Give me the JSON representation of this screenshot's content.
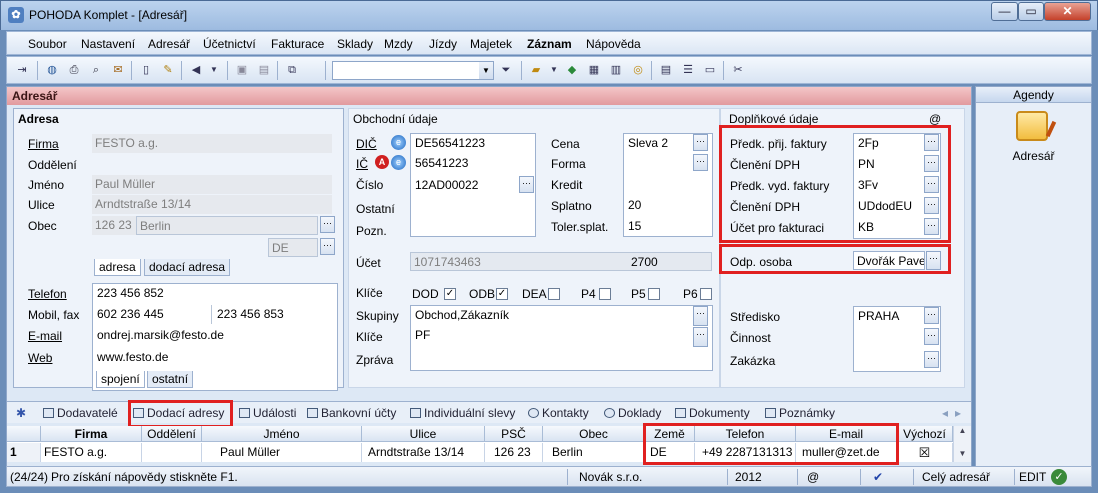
{
  "window": {
    "title": "POHODA Komplet - [Adresář]",
    "btn_min": "—",
    "btn_max": "▭",
    "btn_close": "✕"
  },
  "menu": [
    "Soubor",
    "Nastavení",
    "Adresář",
    "Účetnictví",
    "Fakturace",
    "Sklady",
    "Mzdy",
    "Jízdy",
    "Majetek",
    "Záznam",
    "Nápověda"
  ],
  "panel_title": "Adresář",
  "address": {
    "section_title": "Adresa",
    "labels": {
      "firma": "Firma",
      "oddeleni": "Oddělení",
      "jmeno": "Jméno",
      "ulice": "Ulice",
      "obec": "Obec"
    },
    "firma": "FESTO  a.g.",
    "jmeno": "Paul Müller",
    "ulice": "Arndtstraße 13/14",
    "psc": "126 23",
    "obec": "Berlin",
    "zeme": "DE",
    "tabs": [
      "adresa",
      "dodací adresa"
    ],
    "contact_labels": {
      "telefon": "Telefon",
      "mobil": "Mobil, fax",
      "email": "E-mail",
      "web": "Web"
    },
    "telefon": "223 456 852",
    "mobil": "602 236 445",
    "fax": "223 456 853",
    "email": "ondrej.marsik@festo.de",
    "web": "www.festo.de",
    "contact_tabs": [
      "spojení",
      "ostatní"
    ]
  },
  "business": {
    "section_title": "Obchodní údaje",
    "labels": {
      "dic": "DIČ",
      "ic": "IČ",
      "cislo": "Číslo",
      "ostatni": "Ostatní",
      "pozn": "Pozn.",
      "ucet": "Účet",
      "klice": "Klíče"
    },
    "dic": "DE56541223",
    "ic": "56541223",
    "cislo": "12AD00022",
    "right_labels": {
      "cena": "Cena",
      "forma": "Forma",
      "kredit": "Kredit",
      "splatno": "Splatno",
      "toler": "Toler.splat."
    },
    "cena": "Sleva 2",
    "splatno": "20",
    "toler": "15",
    "ucet": "1071743463",
    "ucet_kod": "2700",
    "keys": [
      {
        "label": "DOD",
        "checked": "✓"
      },
      {
        "label": "ODB",
        "checked": "✓"
      },
      {
        "label": "DEA",
        "checked": ""
      },
      {
        "label": "P4",
        "checked": ""
      },
      {
        "label": "P5",
        "checked": ""
      },
      {
        "label": "P6",
        "checked": ""
      }
    ],
    "lower_labels": {
      "skupiny": "Skupiny",
      "klice": "Klíče",
      "zprava": "Zpráva"
    },
    "skupiny": "Obchod,Zákazník",
    "klice_value": "PF"
  },
  "extra": {
    "section_title": "Doplňkové údaje",
    "at": "@",
    "rows": [
      {
        "label": "Předk. přij. faktury",
        "value": "2Fp"
      },
      {
        "label": "Členění DPH",
        "value": "PN"
      },
      {
        "label": "Předk. vyd. faktury",
        "value": "3Fv"
      },
      {
        "label": "Členění DPH",
        "value": "UDdodEU"
      },
      {
        "label": "Účet pro fakturaci",
        "value": "KB"
      }
    ],
    "odp_label": "Odp. osoba",
    "odp_value": "Dvořák Pavel",
    "stredisko_label": "Středisko",
    "stredisko": "PRAHA",
    "cinnost_label": "Činnost",
    "zakazka_label": "Zakázka"
  },
  "bottom_tabs": [
    "Dodavatelé",
    "Dodací adresy",
    "Události",
    "Bankovní účty",
    "Individuální slevy",
    "Kontakty",
    "Doklady",
    "Dokumenty",
    "Poznámky"
  ],
  "grid": {
    "headers": [
      "Firma",
      "Oddělení",
      "Jméno",
      "Ulice",
      "PSČ",
      "Obec",
      "Země",
      "Telefon",
      "E-mail",
      "Výchozí"
    ],
    "row": {
      "n": "1",
      "firma": "FESTO  a.g.",
      "oddeleni": "",
      "jmeno": "Paul Müller",
      "ulice": "Arndtstraße 13/14",
      "psc": "126 23",
      "obec": "Berlin",
      "zeme": "DE",
      "telefon": "+49 2287131313",
      "email": "muller@zet.de",
      "vychozi": "☒"
    }
  },
  "agenda": {
    "title": "Agendy",
    "item": "Adresář"
  },
  "status": {
    "pos": "(24/24)",
    "help": "Pro získání nápovědy stiskněte F1.",
    "company": "Novák s.r.o.",
    "year": "2012",
    "at": "@",
    "scope": "Celý adresář",
    "mode": "EDIT"
  }
}
